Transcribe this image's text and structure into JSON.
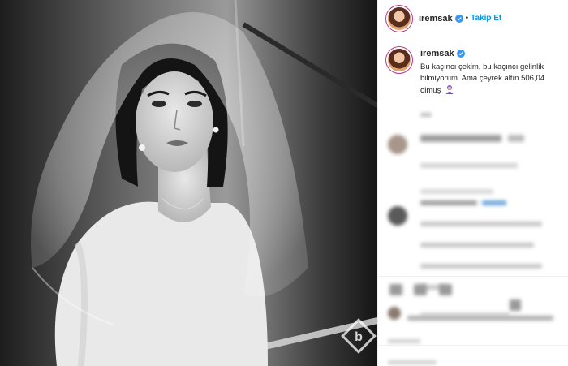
{
  "post": {
    "username": "iremsak",
    "follow_label": "Takip Et",
    "dot": "•",
    "caption_text": "Bu kaçıncı çekim, bu kaçıncı gelinlik bilmiyorum. Ama çeyrek altın 506,04 olmuş",
    "caption_emoji": "woman-emoji"
  },
  "icons": {
    "verified": "verified-badge-icon",
    "watermark": "site-watermark-logo"
  },
  "colors": {
    "follow": "#0095f6",
    "verified": "#3897f0",
    "text": "#262626"
  }
}
